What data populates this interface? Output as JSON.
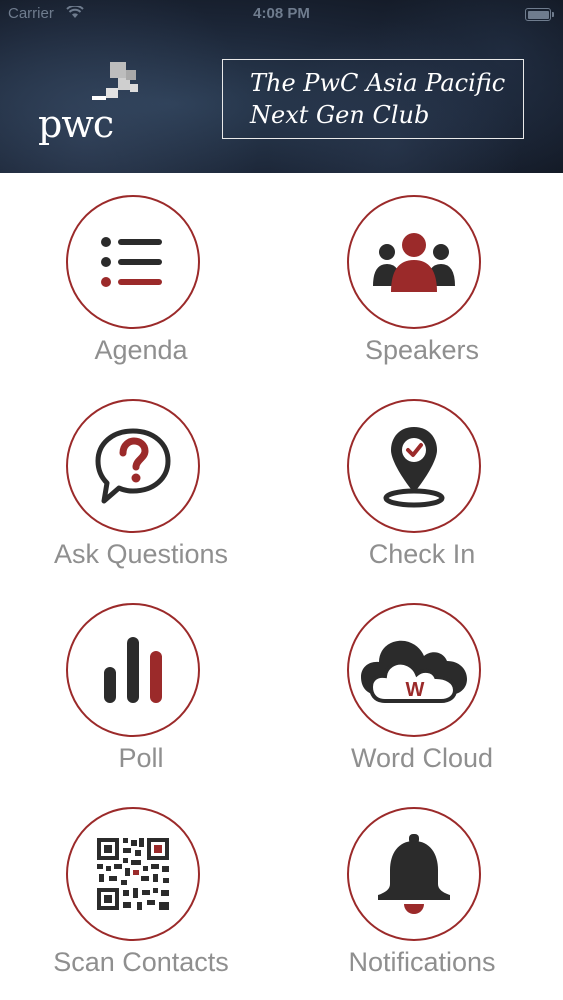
{
  "status_bar": {
    "carrier": "Carrier",
    "time": "4:08 PM"
  },
  "header": {
    "logo_text": "pwc",
    "title": "The PwC Asia Pacific\nNext Gen Club"
  },
  "colors": {
    "accent": "#9b2a2a",
    "icon_dark": "#2b2b2b",
    "label": "#8f8f8f"
  },
  "menu": {
    "agenda": {
      "label": "Agenda",
      "icon": "list-icon"
    },
    "speakers": {
      "label": "Speakers",
      "icon": "people-icon"
    },
    "ask_questions": {
      "label": "Ask Questions",
      "icon": "question-bubble-icon"
    },
    "check_in": {
      "label": "Check In",
      "icon": "location-pin-icon"
    },
    "poll": {
      "label": "Poll",
      "icon": "bar-chart-icon"
    },
    "word_cloud": {
      "label": "Word Cloud",
      "icon": "cloud-icon",
      "icon_letter": "W"
    },
    "scan_contacts": {
      "label": "Scan Contacts",
      "icon": "qr-code-icon"
    },
    "notifications": {
      "label": "Notifications",
      "icon": "bell-icon"
    }
  }
}
